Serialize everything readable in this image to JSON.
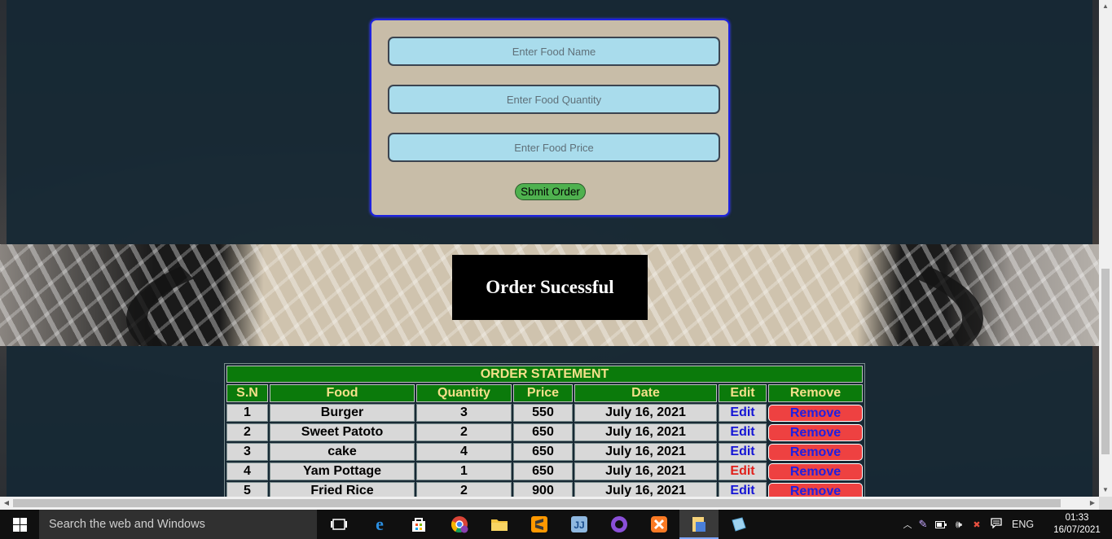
{
  "form": {
    "food_name_placeholder": "Enter Food Name",
    "food_quantity_placeholder": "Enter Food Quantity",
    "food_price_placeholder": "Enter Food Price",
    "submit_label": "Sbmit Order"
  },
  "message": "Order Sucessful",
  "statement": {
    "caption": "ORDER STATEMENT",
    "headers": [
      "S.N",
      "Food",
      "Quantity",
      "Price",
      "Date",
      "Edit",
      "Remove"
    ],
    "rows": [
      {
        "sn": "1",
        "food": "Burger",
        "quantity": "3",
        "price": "550",
        "date": "July 16, 2021",
        "edit": "Edit",
        "remove": "Remove"
      },
      {
        "sn": "2",
        "food": "Sweet Patoto",
        "quantity": "2",
        "price": "650",
        "date": "July 16, 2021",
        "edit": "Edit",
        "remove": "Remove"
      },
      {
        "sn": "3",
        "food": "cake",
        "quantity": "4",
        "price": "650",
        "date": "July 16, 2021",
        "edit": "Edit",
        "remove": "Remove"
      },
      {
        "sn": "4",
        "food": "Yam Pottage",
        "quantity": "1",
        "price": "650",
        "date": "July 16, 2021",
        "edit": "Edit",
        "remove": "Remove"
      },
      {
        "sn": "5",
        "food": "Fried Rice",
        "quantity": "2",
        "price": "900",
        "date": "July 16, 2021",
        "edit": "Edit",
        "remove": "Remove"
      }
    ]
  },
  "taskbar": {
    "search_placeholder": "Search the web and Windows",
    "language": "ENG",
    "time": "01:33",
    "date": "16/07/2021",
    "apps": [
      "task-view-icon",
      "edge-icon",
      "store-icon",
      "chrome-icon",
      "file-explorer-icon",
      "sublime-text-icon",
      "vscode-icon",
      "github-desktop-icon",
      "xampp-icon",
      "file-manager-icon",
      "notepad-icon"
    ]
  },
  "colors": {
    "section_overlay": "#162834",
    "form_border": "#1e22e0",
    "input_bg": "#a9dcec",
    "submit_bg": "#4fb14f",
    "table_header_bg": "#0b7a0b",
    "table_header_text": "#f4e08a",
    "remove_bg": "#ee4141",
    "link_blue": "#1515d5",
    "edit_hover_red": "#e0201a"
  }
}
